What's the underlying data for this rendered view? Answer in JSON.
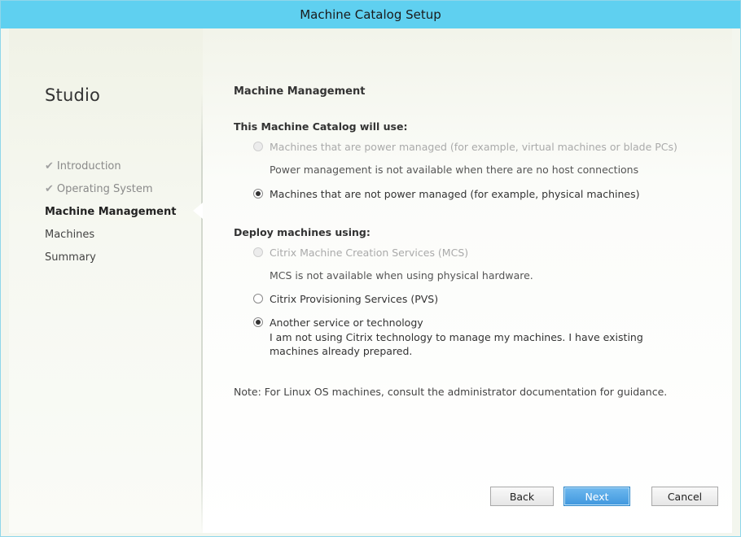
{
  "window": {
    "title": "Machine Catalog Setup"
  },
  "sidebar": {
    "heading": "Studio",
    "steps": [
      {
        "label": "Introduction",
        "state": "done"
      },
      {
        "label": "Operating System",
        "state": "done"
      },
      {
        "label": "Machine Management",
        "state": "current"
      },
      {
        "label": "Machines",
        "state": "todo"
      },
      {
        "label": "Summary",
        "state": "todo"
      }
    ]
  },
  "main": {
    "title": "Machine Management",
    "group1": {
      "label": "This Machine Catalog will use:",
      "options": [
        {
          "label": "Machines that are power managed (for example, virtual machines or blade PCs)",
          "disabled": true,
          "checked": false
        },
        {
          "label": "Machines that are not power managed (for example, physical machines)",
          "disabled": false,
          "checked": true
        }
      ],
      "power_note": "Power management is not available when there are no host connections"
    },
    "group2": {
      "label": "Deploy machines using:",
      "options": [
        {
          "label": "Citrix Machine Creation Services (MCS)",
          "disabled": true,
          "checked": false
        },
        {
          "label": "Citrix Provisioning Services (PVS)",
          "disabled": false,
          "checked": false
        },
        {
          "label": "Another service or technology",
          "disabled": false,
          "checked": true
        }
      ],
      "mcs_note": "MCS is not available when using physical hardware.",
      "another_desc": "I am not using Citrix technology to manage my machines. I have existing machines already prepared."
    },
    "footer_note": "Note: For Linux OS machines, consult the administrator documentation for guidance."
  },
  "buttons": {
    "back": "Back",
    "next": "Next",
    "cancel": "Cancel"
  },
  "icons": {
    "check": "check-icon"
  },
  "colors": {
    "titlebar": "#5fd0f0",
    "primary_button": "#3f97de"
  }
}
